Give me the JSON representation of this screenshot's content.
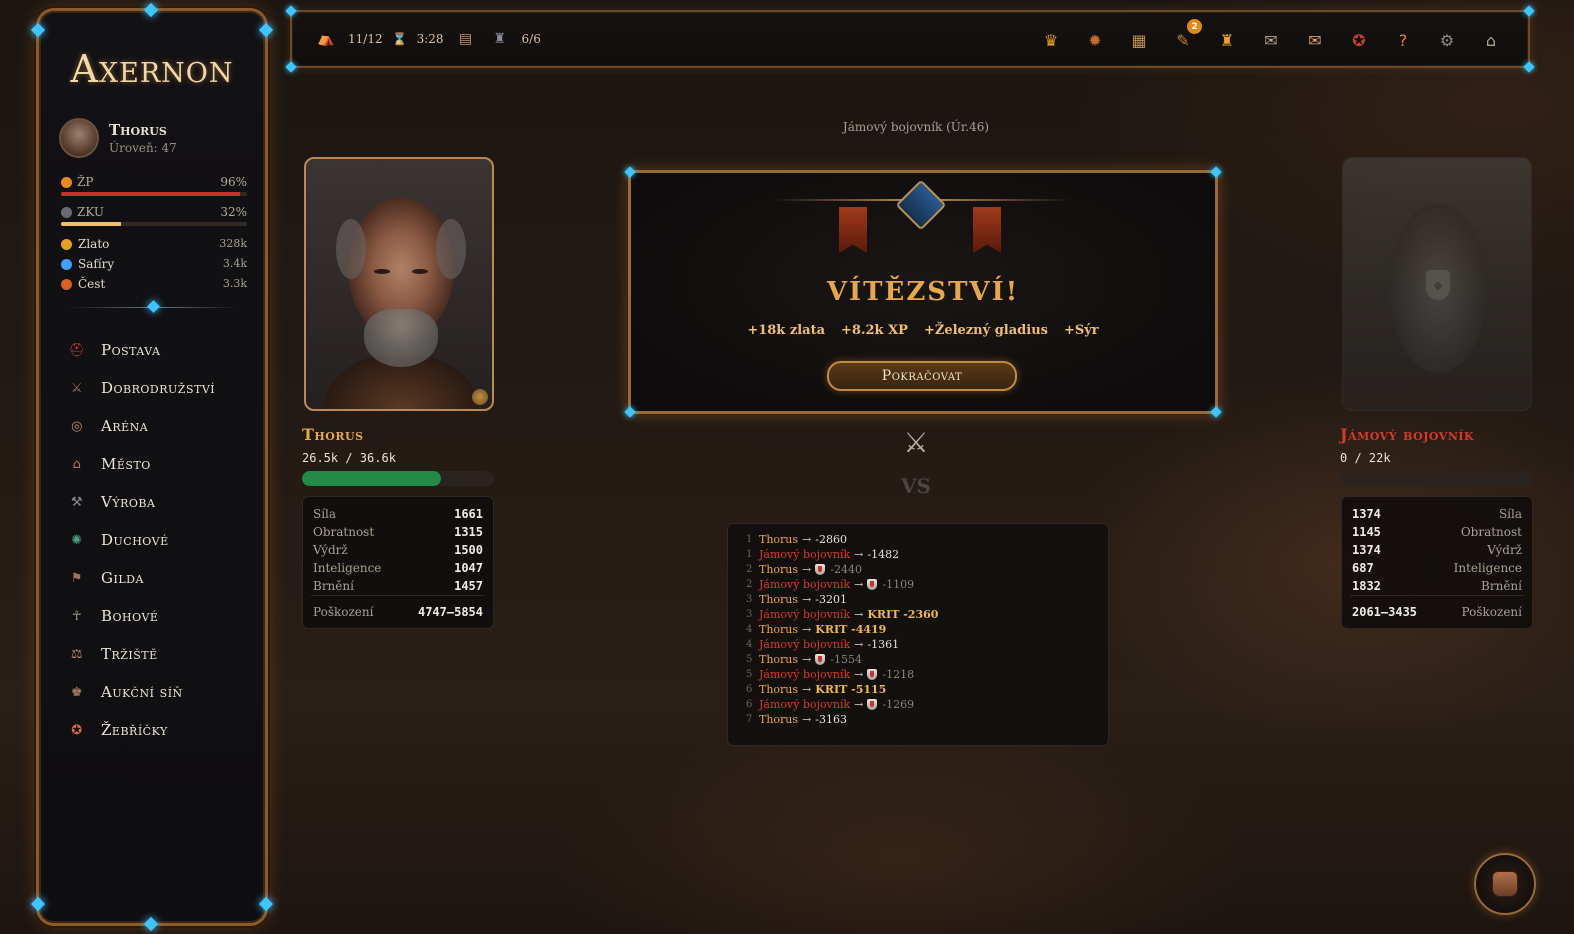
{
  "app": {
    "logo": "Axernon"
  },
  "player": {
    "name": "Thorus",
    "level_text": "Úroveň: 47",
    "hp": {
      "label": "ŽP",
      "percent_text": "96%",
      "fraction": 0.96,
      "color": "#c8302a"
    },
    "xp": {
      "label": "ZKU",
      "percent_text": "32%",
      "fraction": 0.32,
      "color": "#f0c070"
    },
    "resources": [
      {
        "name": "Zlato",
        "value": "328k",
        "icon": "coin-icon",
        "color": "#e8a020"
      },
      {
        "name": "Safíry",
        "value": "3.4k",
        "icon": "sapphire-icon",
        "color": "#3ea0ff"
      },
      {
        "name": "Čest",
        "value": "3.3k",
        "icon": "honor-icon",
        "color": "#d86020"
      }
    ]
  },
  "nav": [
    {
      "label": "Postava",
      "icon": "helmet-icon",
      "glyph": "⛑",
      "color": "#c04030"
    },
    {
      "label": "Dobrodružství",
      "icon": "adventurer-icon",
      "glyph": "⚔",
      "color": "#a07050"
    },
    {
      "label": "Aréna",
      "icon": "arena-icon",
      "glyph": "◎",
      "color": "#c09060"
    },
    {
      "label": "Město",
      "icon": "town-icon",
      "glyph": "⌂",
      "color": "#c07050"
    },
    {
      "label": "Výroba",
      "icon": "hammer-icon",
      "glyph": "⚒",
      "color": "#8a8a90"
    },
    {
      "label": "Duchové",
      "icon": "spirit-icon",
      "glyph": "✺",
      "color": "#50a080"
    },
    {
      "label": "Gilda",
      "icon": "guild-icon",
      "glyph": "⚑",
      "color": "#a07060"
    },
    {
      "label": "Bohové",
      "icon": "god-icon",
      "glyph": "☥",
      "color": "#b0a090"
    },
    {
      "label": "Tržiště",
      "icon": "market-icon",
      "glyph": "⚖",
      "color": "#c08070"
    },
    {
      "label": "Aukční síň",
      "icon": "auction-icon",
      "glyph": "♚",
      "color": "#b08060"
    },
    {
      "label": "Žebříčky",
      "icon": "rankings-icon",
      "glyph": "✪",
      "color": "#e07030"
    }
  ],
  "topbar": {
    "energy": "11/12",
    "timer": "3:28",
    "dungeon": "6/6",
    "buttons": [
      {
        "icon": "crown-icon",
        "glyph": "♛",
        "color": "#e8a020"
      },
      {
        "icon": "wheel-icon",
        "glyph": "✹",
        "color": "#c07030"
      },
      {
        "icon": "map-icon",
        "glyph": "▦",
        "color": "#c09050"
      },
      {
        "icon": "scroll-icon",
        "glyph": "✎",
        "color": "#c08040",
        "badge": "2"
      },
      {
        "icon": "trophy-icon",
        "glyph": "♜",
        "color": "#e8a020"
      },
      {
        "icon": "letters-icon",
        "glyph": "✉",
        "color": "#c0a080"
      },
      {
        "icon": "mail-icon",
        "glyph": "✉",
        "color": "#d8a070"
      },
      {
        "icon": "medal-icon",
        "glyph": "✪",
        "color": "#c84030"
      },
      {
        "icon": "help-icon",
        "glyph": "?",
        "color": "#e88020"
      },
      {
        "icon": "settings-icon",
        "glyph": "⚙",
        "color": "#8a8a8a"
      },
      {
        "icon": "temple-icon",
        "glyph": "⌂",
        "color": "#b0a090"
      }
    ]
  },
  "fight": {
    "title": "Jámový bojovník (Úr.46)",
    "victory_text": "VÍTĚZSTVÍ!",
    "rewards": [
      "+18k zlata",
      "+8.2k XP",
      "+Železný gladius",
      "+Sýr"
    ],
    "continue_label": "Pokračovat",
    "vs_text": "VS",
    "left": {
      "name": "Thorus",
      "hp_text": "26.5k / 36.6k",
      "hp_fraction": 0.724,
      "stats": [
        {
          "name": "Síla",
          "value": "1661"
        },
        {
          "name": "Obratnost",
          "value": "1315"
        },
        {
          "name": "Výdrž",
          "value": "1500"
        },
        {
          "name": "Inteligence",
          "value": "1047"
        },
        {
          "name": "Brnění",
          "value": "1457"
        }
      ],
      "damage": {
        "name": "Poškození",
        "value": "4747–5854"
      }
    },
    "right": {
      "name": "Jámový bojovník",
      "hp_text": "0 / 22k",
      "hp_fraction": 0,
      "stats": [
        {
          "name": "Síla",
          "value": "1374"
        },
        {
          "name": "Obratnost",
          "value": "1145"
        },
        {
          "name": "Výdrž",
          "value": "1374"
        },
        {
          "name": "Inteligence",
          "value": "687"
        },
        {
          "name": "Brnění",
          "value": "1832"
        }
      ],
      "damage": {
        "name": "Poškození",
        "value": "2061–3435"
      }
    },
    "log": [
      {
        "round": "1",
        "attacker": "Thorus",
        "side": "p",
        "result": "-2860",
        "type": "hit"
      },
      {
        "round": "1",
        "attacker": "Jámový bojovník",
        "side": "e",
        "result": "-1482",
        "type": "hit"
      },
      {
        "round": "2",
        "attacker": "Thorus",
        "side": "p",
        "result": "-2440",
        "type": "block"
      },
      {
        "round": "2",
        "attacker": "Jámový bojovník",
        "side": "e",
        "result": "-1109",
        "type": "block"
      },
      {
        "round": "3",
        "attacker": "Thorus",
        "side": "p",
        "result": "-3201",
        "type": "hit"
      },
      {
        "round": "3",
        "attacker": "Jámový bojovník",
        "side": "e",
        "result": "KRIT -2360",
        "type": "crit"
      },
      {
        "round": "4",
        "attacker": "Thorus",
        "side": "p",
        "result": "KRIT -4419",
        "type": "crit"
      },
      {
        "round": "4",
        "attacker": "Jámový bojovník",
        "side": "e",
        "result": "-1361",
        "type": "hit"
      },
      {
        "round": "5",
        "attacker": "Thorus",
        "side": "p",
        "result": "-1554",
        "type": "block"
      },
      {
        "round": "5",
        "attacker": "Jámový bojovník",
        "side": "e",
        "result": "-1218",
        "type": "block"
      },
      {
        "round": "6",
        "attacker": "Thorus",
        "side": "p",
        "result": "KRIT -5115",
        "type": "crit"
      },
      {
        "round": "6",
        "attacker": "Jámový bojovník",
        "side": "e",
        "result": "-1269",
        "type": "block"
      },
      {
        "round": "7",
        "attacker": "Thorus",
        "side": "p",
        "result": "-3163",
        "type": "hit"
      }
    ]
  }
}
